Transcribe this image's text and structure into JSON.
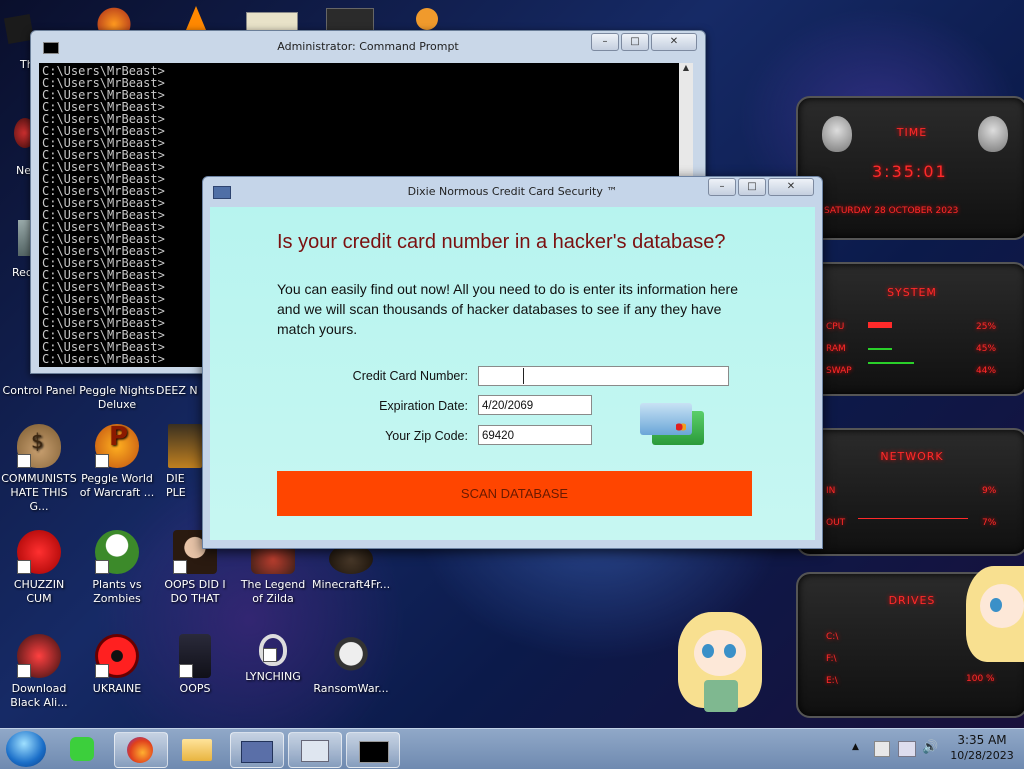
{
  "desktop": {
    "icons": [
      {
        "label": "Control Panel"
      },
      {
        "label": "Peggle Nights Deluxe"
      },
      {
        "label": "DEEZ N"
      },
      {
        "label": "COMMUNISTS HATE THIS G..."
      },
      {
        "label": "Peggle World of Warcraft ..."
      },
      {
        "label": "DIE PLE"
      },
      {
        "label": "CHUZZIN CUM"
      },
      {
        "label": "Plants vs Zombies"
      },
      {
        "label": "OOPS DID I DO THAT"
      },
      {
        "label": "The Legend of Zilda"
      },
      {
        "label": "Minecraft4Fr..."
      },
      {
        "label": "Download Black Ali..."
      },
      {
        "label": "UKRAINE"
      },
      {
        "label": "OOPS"
      },
      {
        "label": "LYNCHING"
      },
      {
        "label": "RansomWar..."
      }
    ],
    "partial_labels": {
      "top": "Th",
      "ne": "Ne",
      "rec": "Rec"
    }
  },
  "cmd_window": {
    "title": "Administrator: Command Prompt",
    "prompt_line": "C:\\Users\\MrBeast>",
    "line_count": 25
  },
  "dialog": {
    "title": "Dixie Normous Credit Card Security ™",
    "heading": "Is your credit card number in a hacker's database?",
    "description": "You can easily find out now! All you need to do is enter its information here and we will scan thousands of hacker databases to see if any they have match yours.",
    "fields": {
      "card_label": "Credit Card Number:",
      "card_value": "",
      "exp_label": "Expiration Date:",
      "exp_value": "4/20/2069",
      "zip_label": "Your Zip Code:",
      "zip_value": "69420"
    },
    "scan_button": "SCAN DATABASE"
  },
  "widget": {
    "time_header": "TIME",
    "time": "3:35:01",
    "date": "SATURDAY 28 OCTOBER 2023",
    "system_header": "SYSTEM",
    "cpu_label": "CPU",
    "cpu_value": "25%",
    "ram_label": "RAM",
    "ram_value": "45%",
    "swap_label": "SWAP",
    "swap_value": "44%",
    "network_header": "NETWORK",
    "in_label": "IN",
    "in_value": "9%",
    "out_label": "OUT",
    "out_value": "7%",
    "drives_header": "DRIVES",
    "drive_c": "C:\\",
    "drive_f": "F:\\",
    "drive_e": "E:\\",
    "drive_e_value": "100 %"
  },
  "taskbar": {
    "clock_time": "3:35 AM",
    "clock_date": "10/28/2023"
  }
}
